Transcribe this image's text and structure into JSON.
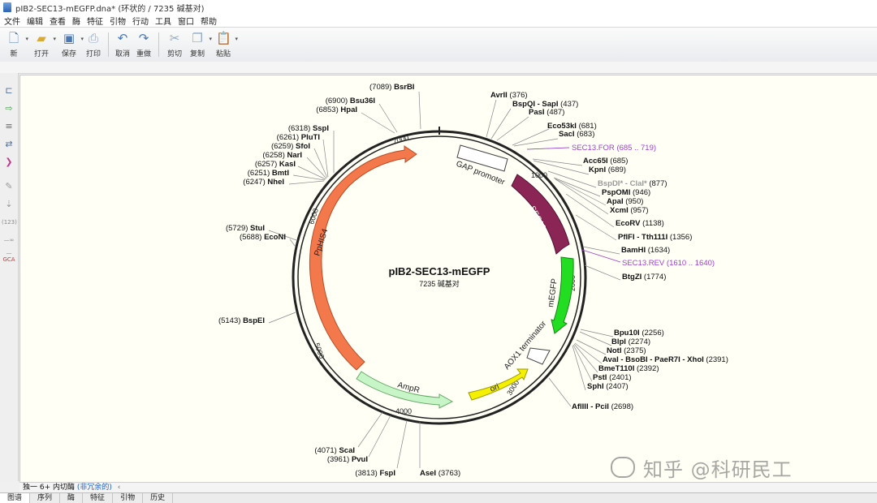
{
  "window": {
    "title": "pIB2-SEC13-mEGFP.dna* (环状的 / 7235 碱基对)"
  },
  "menu": [
    "文件",
    "编辑",
    "查看",
    "酶",
    "特征",
    "引物",
    "行动",
    "工具",
    "窗口",
    "帮助"
  ],
  "toolbar": {
    "new": "新",
    "open": "打开",
    "save": "保存",
    "print": "打印",
    "undo": "取消",
    "redo": "重做",
    "cut": "剪切",
    "copy": "复制",
    "paste": "粘贴"
  },
  "map": {
    "name": "pIB2-SEC13-mEGFP",
    "length": "7235 碱基对",
    "ticks": [
      "1000",
      "2000",
      "3000",
      "4000",
      "5000",
      "6000",
      "7000"
    ],
    "features": [
      "GAP promoter",
      "SEC13",
      "mEGFP",
      "AOX1 terminator",
      "ori",
      "AmpR",
      "PpHIS4"
    ],
    "right_sites": [
      {
        "name": "BsrBI",
        "pos": "(7089)"
      },
      {
        "name": "AvrII",
        "pos": "(376)"
      },
      {
        "name": "BspQI - SapI",
        "pos": "(437)"
      },
      {
        "name": "PasI",
        "pos": "(487)"
      },
      {
        "name": "Eco53kI",
        "pos": "(681)"
      },
      {
        "name": "SacI",
        "pos": "(683)"
      },
      {
        "name": "Acc65I",
        "pos": "(685)"
      },
      {
        "name": "KpnI",
        "pos": "(689)"
      },
      {
        "name": "BspDI* - ClaI*",
        "pos": "(877)"
      },
      {
        "name": "PspOMI",
        "pos": "(946)"
      },
      {
        "name": "ApaI",
        "pos": "(950)"
      },
      {
        "name": "XcmI",
        "pos": "(957)"
      },
      {
        "name": "EcoRV",
        "pos": "(1138)"
      },
      {
        "name": "PflFI - Tth111I",
        "pos": "(1356)"
      },
      {
        "name": "BamHI",
        "pos": "(1634)"
      },
      {
        "name": "BtgZI",
        "pos": "(1774)"
      },
      {
        "name": "Bpu10I",
        "pos": "(2256)"
      },
      {
        "name": "BlpI",
        "pos": "(2274)"
      },
      {
        "name": "NotI",
        "pos": "(2375)"
      },
      {
        "name": "AvaI - BsoBI - PaeR7I - XhoI",
        "pos": "(2391)"
      },
      {
        "name": "BmeT110I",
        "pos": "(2392)"
      },
      {
        "name": "PstI",
        "pos": "(2401)"
      },
      {
        "name": "SphI",
        "pos": "(2407)"
      },
      {
        "name": "AflIII - PciI",
        "pos": "(2698)"
      }
    ],
    "primers": [
      {
        "name": "SEC13.FOR",
        "range": "(685 .. 719)"
      },
      {
        "name": "SEC13.REV",
        "range": "(1610 .. 1640)"
      }
    ],
    "left_sites": [
      {
        "name": "Bsu36I",
        "pos": "(6900)"
      },
      {
        "name": "HpaI",
        "pos": "(6853)"
      },
      {
        "name": "SspI",
        "pos": "(6318)"
      },
      {
        "name": "PluTI",
        "pos": "(6261)"
      },
      {
        "name": "SfoI",
        "pos": "(6259)"
      },
      {
        "name": "NarI",
        "pos": "(6258)"
      },
      {
        "name": "KasI",
        "pos": "(6257)"
      },
      {
        "name": "BmtI",
        "pos": "(6251)"
      },
      {
        "name": "NheI",
        "pos": "(6247)"
      },
      {
        "name": "StuI",
        "pos": "(5729)"
      },
      {
        "name": "EcoNI",
        "pos": "(5688)"
      },
      {
        "name": "BspEI",
        "pos": "(5143)"
      }
    ],
    "bottom_sites": [
      {
        "name": "ScaI",
        "pos": "(4071)"
      },
      {
        "name": "PvuI",
        "pos": "(3961)"
      },
      {
        "name": "FspI",
        "pos": "(3813)"
      },
      {
        "name": "AseI",
        "pos": "(3763)"
      }
    ]
  },
  "status": {
    "text": "独一 6+ 内切酶",
    "hint": "(非冗余的)"
  },
  "watermark": "知乎 @科研民工",
  "tabs": [
    "图谱",
    "序列",
    "酶",
    "特征",
    "引物",
    "历史"
  ],
  "colors": {
    "ppHIS4": "#f3784c",
    "sec13": "#8b2556",
    "megfp": "#22dd22",
    "ori": "#f4f000",
    "ampr": "#c8f5c8",
    "primer": "#a040d0"
  }
}
